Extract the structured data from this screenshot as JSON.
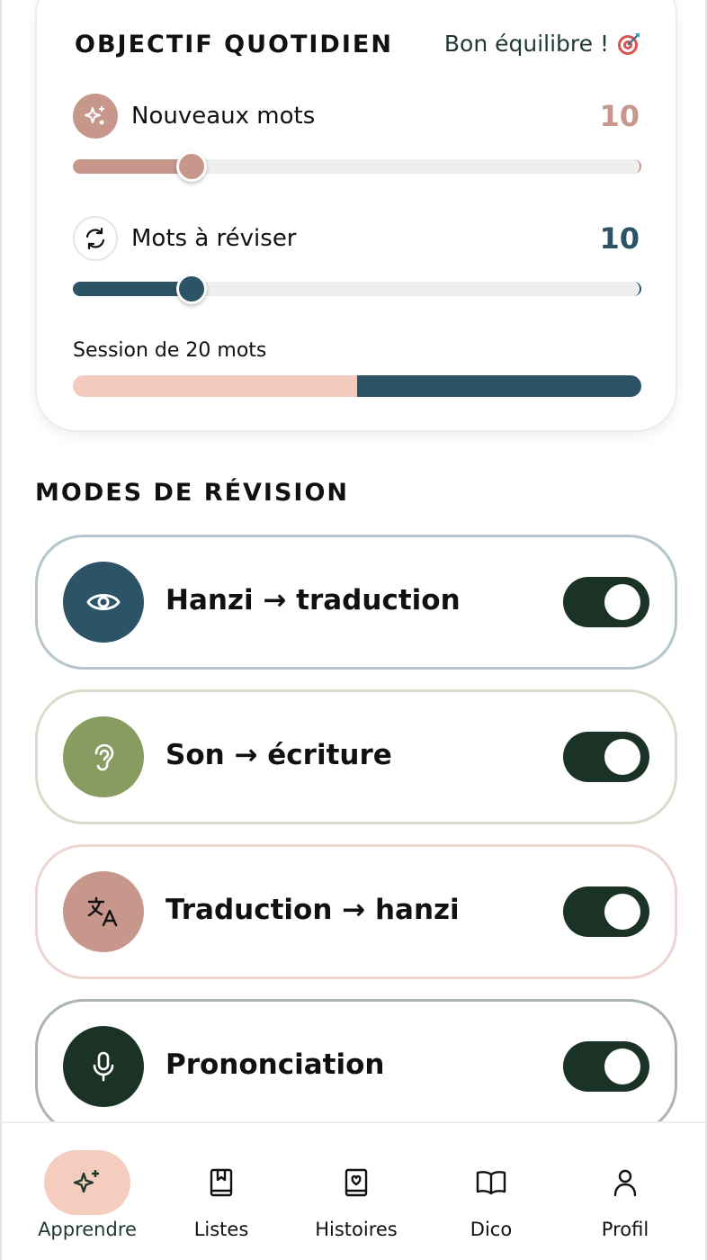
{
  "goal": {
    "title": "OBJECTIF QUOTIDIEN",
    "status": "Bon équilibre !",
    "status_icon": "target-icon",
    "new_words": {
      "label": "Nouveaux mots",
      "value": "10",
      "icon": "sparkle-icon",
      "fraction": 0.21,
      "color": "#c8978c"
    },
    "review_words": {
      "label": "Mots à réviser",
      "value": "10",
      "icon": "refresh-icon",
      "fraction": 0.21,
      "color": "#2c5366"
    },
    "session": {
      "label": "Session de 20 mots",
      "new_share": 0.5,
      "review_share": 0.5
    }
  },
  "modes": {
    "title": "MODES DE RÉVISION",
    "items": [
      {
        "label": "Hanzi → traduction",
        "icon": "eye-icon",
        "icon_bg": "#2c5366",
        "border": "#b4c5cc",
        "enabled": true
      },
      {
        "label": "Son → écriture",
        "icon": "ear-icon",
        "icon_bg": "#889b60",
        "border": "#d8dccb",
        "enabled": true
      },
      {
        "label": "Traduction → hanzi",
        "icon": "translate-icon",
        "icon_bg": "#c8978c",
        "border": "#ecd6d2",
        "enabled": true
      },
      {
        "label": "Prononciation",
        "icon": "microphone-icon",
        "icon_bg": "#1b3327",
        "border": "#aab5b1",
        "enabled": true
      }
    ]
  },
  "nav": {
    "items": [
      {
        "label": "Apprendre",
        "icon": "sparkle-icon",
        "active": true
      },
      {
        "label": "Listes",
        "icon": "bookmark-book-icon",
        "active": false
      },
      {
        "label": "Histoires",
        "icon": "heart-book-icon",
        "active": false
      },
      {
        "label": "Dico",
        "icon": "open-book-icon",
        "active": false
      },
      {
        "label": "Profil",
        "icon": "user-icon",
        "active": false
      }
    ]
  },
  "colors": {
    "accent_dark": "#1b3327",
    "accent_blue": "#2c5366",
    "accent_rose": "#c8978c",
    "accent_peach": "#f4cdbf"
  }
}
